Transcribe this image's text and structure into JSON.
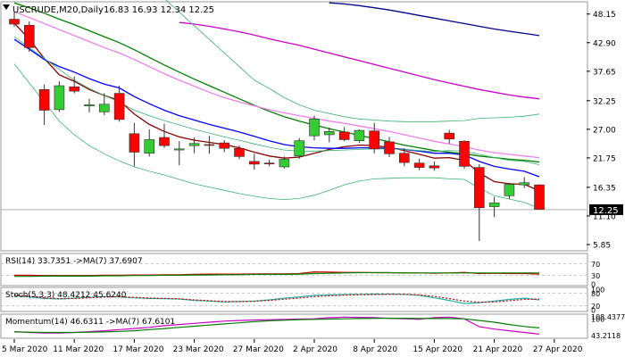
{
  "chart_data": {
    "type": "candlestick",
    "title": "USCRUDE,M20,Daily",
    "ohlc_label": "16.83 16.93 12.34 12.25",
    "last_price_label": "12.25",
    "last_price": 12.25,
    "y_ticks": [
      "48.15",
      "42.90",
      "37.65",
      "32.25",
      "27.00",
      "21.75",
      "16.35",
      "11.10",
      "5.85"
    ],
    "y_tick_values": [
      48.15,
      42.9,
      37.65,
      32.25,
      27.0,
      21.75,
      16.35,
      11.1,
      5.85
    ],
    "ylim": [
      4.7,
      50.4
    ],
    "x_labels": [
      "5 Mar 2020",
      "11 Mar 2020",
      "17 Mar 2020",
      "23 Mar 2020",
      "27 Mar 2020",
      "2 Apr 2020",
      "8 Apr 2020",
      "15 Apr 2020",
      "21 Apr 2020",
      "27 Apr 2020"
    ],
    "x_label_bar_index": [
      0,
      4,
      8,
      12,
      16,
      20,
      24,
      28,
      32,
      36
    ],
    "candles": [
      {
        "o": 47.2,
        "h": 48.5,
        "l": 45.8,
        "c": 46.3
      },
      {
        "o": 46.1,
        "h": 46.8,
        "l": 41.2,
        "c": 42.0
      },
      {
        "o": 34.3,
        "h": 35.2,
        "l": 27.8,
        "c": 30.5
      },
      {
        "o": 30.6,
        "h": 35.8,
        "l": 30.2,
        "c": 35.0
      },
      {
        "o": 34.8,
        "h": 36.7,
        "l": 33.6,
        "c": 34.0
      },
      {
        "o": 31.3,
        "h": 32.6,
        "l": 30.1,
        "c": 31.5
      },
      {
        "o": 30.2,
        "h": 33.6,
        "l": 29.6,
        "c": 31.6
      },
      {
        "o": 33.6,
        "h": 35.0,
        "l": 28.4,
        "c": 28.8
      },
      {
        "o": 26.2,
        "h": 28.2,
        "l": 20.2,
        "c": 22.8
      },
      {
        "o": 22.6,
        "h": 27.0,
        "l": 22.0,
        "c": 25.1
      },
      {
        "o": 25.5,
        "h": 28.0,
        "l": 23.6,
        "c": 24.0
      },
      {
        "o": 23.2,
        "h": 24.8,
        "l": 20.4,
        "c": 23.4
      },
      {
        "o": 24.0,
        "h": 25.5,
        "l": 22.6,
        "c": 24.4
      },
      {
        "o": 24.2,
        "h": 25.8,
        "l": 22.5,
        "c": 24.1
      },
      {
        "o": 24.5,
        "h": 25.0,
        "l": 22.8,
        "c": 23.5
      },
      {
        "o": 23.5,
        "h": 24.0,
        "l": 21.5,
        "c": 22.0
      },
      {
        "o": 21.1,
        "h": 22.5,
        "l": 19.6,
        "c": 20.6
      },
      {
        "o": 20.8,
        "h": 21.4,
        "l": 20.2,
        "c": 20.7
      },
      {
        "o": 20.1,
        "h": 22.0,
        "l": 19.8,
        "c": 21.5
      },
      {
        "o": 22.1,
        "h": 25.4,
        "l": 21.6,
        "c": 24.9
      },
      {
        "o": 25.8,
        "h": 29.5,
        "l": 25.0,
        "c": 28.9
      },
      {
        "o": 26.0,
        "h": 27.3,
        "l": 24.6,
        "c": 26.6
      },
      {
        "o": 26.5,
        "h": 27.4,
        "l": 24.8,
        "c": 25.1
      },
      {
        "o": 24.9,
        "h": 27.0,
        "l": 24.5,
        "c": 26.8
      },
      {
        "o": 26.7,
        "h": 28.2,
        "l": 22.6,
        "c": 23.4
      },
      {
        "o": 24.7,
        "h": 25.6,
        "l": 21.9,
        "c": 22.5
      },
      {
        "o": 22.6,
        "h": 23.5,
        "l": 20.2,
        "c": 20.9
      },
      {
        "o": 20.8,
        "h": 21.6,
        "l": 19.5,
        "c": 20.0
      },
      {
        "o": 20.3,
        "h": 21.1,
        "l": 19.4,
        "c": 19.9
      },
      {
        "o": 26.3,
        "h": 26.9,
        "l": 24.4,
        "c": 25.2
      },
      {
        "o": 24.8,
        "h": 25.0,
        "l": 19.8,
        "c": 20.2
      },
      {
        "o": 20.0,
        "h": 20.6,
        "l": 6.5,
        "c": 12.6
      },
      {
        "o": 12.8,
        "h": 14.6,
        "l": 10.9,
        "c": 13.5
      },
      {
        "o": 14.8,
        "h": 17.2,
        "l": 14.2,
        "c": 16.9
      },
      {
        "o": 16.8,
        "h": 18.2,
        "l": 16.2,
        "c": 17.2
      },
      {
        "o": 16.8,
        "h": 16.9,
        "l": 12.3,
        "c": 12.3
      }
    ],
    "overlay_lines": [
      {
        "role": "ma-darkred",
        "color": "#8b0000",
        "values": [
          46.5,
          43.5,
          40.0,
          37.0,
          35.8,
          34.3,
          33.2,
          32.3,
          29.8,
          27.9,
          26.6,
          25.6,
          25.0,
          24.6,
          24.2,
          23.6,
          22.8,
          22.1,
          21.7,
          21.9,
          22.6,
          23.3,
          23.8,
          24.1,
          24.0,
          23.7,
          23.1,
          22.4,
          21.7,
          21.8,
          21.3,
          19.0,
          17.4,
          17.0,
          16.9,
          15.7
        ]
      },
      {
        "role": "ma-blue",
        "color": "#0000ff",
        "values": [
          43.5,
          41.7,
          39.8,
          38.5,
          37.5,
          36.3,
          35.3,
          34.6,
          33.0,
          31.7,
          30.5,
          29.5,
          28.7,
          27.9,
          27.2,
          26.5,
          25.7,
          24.9,
          24.2,
          23.8,
          23.6,
          23.5,
          23.5,
          23.6,
          23.6,
          23.5,
          23.3,
          23.0,
          22.6,
          22.6,
          22.3,
          21.1,
          20.2,
          19.7,
          19.3,
          18.3
        ]
      },
      {
        "role": "ma-green",
        "color": "#008000",
        "values": [
          50.2,
          49.3,
          48.3,
          47.2,
          46.2,
          45.1,
          44.0,
          42.9,
          41.6,
          40.2,
          38.8,
          37.5,
          36.2,
          35.0,
          33.8,
          32.6,
          31.4,
          30.3,
          29.3,
          28.5,
          27.8,
          27.1,
          26.5,
          25.9,
          25.3,
          24.7,
          24.1,
          23.6,
          23.1,
          22.8,
          22.5,
          22.1,
          21.8,
          21.5,
          21.3,
          21.0
        ]
      },
      {
        "role": "ma-darkblue",
        "color": "#00008b",
        "values": [
          null,
          null,
          null,
          null,
          null,
          null,
          null,
          null,
          null,
          null,
          null,
          null,
          null,
          null,
          null,
          null,
          null,
          null,
          null,
          null,
          null,
          50.2,
          50.0,
          49.7,
          49.3,
          48.9,
          48.4,
          47.9,
          47.4,
          46.9,
          46.4,
          45.9,
          45.4,
          45.0,
          44.6,
          44.2
        ]
      },
      {
        "role": "ma-magenta",
        "color": "#cc00cc",
        "values": [
          null,
          null,
          null,
          null,
          null,
          null,
          null,
          null,
          null,
          null,
          null,
          46.6,
          46.3,
          45.9,
          45.4,
          44.9,
          44.3,
          43.6,
          43.0,
          42.4,
          41.7,
          41.0,
          40.3,
          39.6,
          38.9,
          38.2,
          37.5,
          36.8,
          36.1,
          35.5,
          34.9,
          34.3,
          33.8,
          33.3,
          32.9,
          32.6
        ]
      },
      {
        "role": "ma-violet",
        "color": "#ee82ee",
        "values": [
          48.6,
          47.5,
          46.4,
          45.3,
          44.2,
          43.1,
          42.0,
          41.0,
          39.8,
          38.5,
          37.2,
          36.0,
          34.9,
          33.8,
          32.8,
          32.0,
          31.3,
          30.6,
          30.0,
          29.5,
          29.0,
          28.5,
          28.1,
          27.6,
          27.1,
          26.6,
          26.0,
          25.4,
          24.8,
          24.3,
          23.8,
          23.2,
          22.7,
          22.4,
          22.1,
          21.8
        ]
      },
      {
        "role": "bollinger-upper",
        "color": "#3cb371",
        "values": [
          null,
          null,
          null,
          null,
          null,
          null,
          null,
          null,
          null,
          null,
          51.0,
          48.5,
          46.0,
          43.5,
          41.0,
          38.5,
          36.0,
          34.5,
          32.8,
          31.5,
          30.5,
          29.9,
          29.3,
          28.9,
          28.7,
          28.5,
          28.4,
          28.4,
          28.4,
          28.5,
          28.6,
          29.0,
          29.1,
          29.2,
          29.4,
          29.8
        ]
      },
      {
        "role": "bollinger-middle",
        "color": "#3cb371",
        "values": [
          44.0,
          42.0,
          40.0,
          38.0,
          36.0,
          34.5,
          33.2,
          32.0,
          30.5,
          29.5,
          28.6,
          27.8,
          27.0,
          26.3,
          25.6,
          25.0,
          24.3,
          23.7,
          23.2,
          23.0,
          23.0,
          23.1,
          23.2,
          23.3,
          23.4,
          23.4,
          23.3,
          23.1,
          22.9,
          23.1,
          23.0,
          22.4,
          21.8,
          21.3,
          21.1,
          20.5
        ]
      },
      {
        "role": "bollinger-lower",
        "color": "#3cb371",
        "values": [
          39.0,
          35.5,
          32.0,
          28.5,
          26.0,
          24.0,
          22.5,
          21.2,
          20.1,
          19.3,
          18.6,
          17.8,
          17.0,
          16.4,
          15.8,
          15.2,
          14.7,
          14.3,
          14.1,
          14.3,
          14.9,
          15.8,
          16.8,
          17.5,
          17.9,
          18.0,
          18.1,
          18.1,
          18.1,
          17.9,
          17.8,
          16.2,
          14.8,
          14.2,
          13.6,
          12.5
        ]
      }
    ],
    "panels": [
      {
        "label": "RSI(14) 33.7351 ->MA(7) 37.6907",
        "ticks": [
          "70",
          "30",
          "0"
        ],
        "tick_values": [
          70,
          30,
          0
        ],
        "ylim": [
          0,
          100
        ],
        "levels": [
          70,
          30
        ],
        "lines": [
          {
            "color": "#cc0000",
            "values": [
              30,
              30,
              29,
              29,
              29,
              29,
              30,
              30,
              31,
              31,
              32,
              32,
              33,
              34,
              34,
              34,
              35,
              35,
              35,
              36,
              42,
              41,
              40,
              40,
              39,
              39,
              38,
              38,
              37,
              38,
              40,
              36,
              37,
              36,
              36,
              34
            ]
          },
          {
            "color": "#008000",
            "values": [
              26,
              26,
              27,
              27,
              27,
              27,
              28,
              28,
              29,
              29,
              30,
              30,
              31,
              31,
              32,
              32,
              33,
              33,
              33,
              34,
              36,
              37,
              38,
              39,
              39,
              39,
              38,
              38,
              38,
              38,
              38,
              38,
              38,
              38,
              38,
              38
            ]
          }
        ]
      },
      {
        "label": "Stoch(5,3,3) 48.4212 45.6240",
        "ticks": [
          "100",
          "80",
          "20",
          "0"
        ],
        "tick_values": [
          100,
          80,
          20,
          0
        ],
        "ylim": [
          0,
          100
        ],
        "levels": [
          80,
          20
        ],
        "lines": [
          {
            "color": "#20b2aa",
            "values": [
              70,
              62,
              55,
              52,
              56,
              60,
              64,
              62,
              58,
              55,
              54,
              52,
              45,
              42,
              38,
              40,
              42,
              48,
              56,
              62,
              70,
              72,
              74,
              75,
              76,
              76,
              75,
              70,
              58,
              45,
              30,
              34,
              42,
              50,
              56,
              48
            ]
          },
          {
            "color": "#cc0000",
            "values": [
              72,
              66,
              58,
              54,
              55,
              58,
              62,
              63,
              60,
              57,
              55,
              53,
              48,
              44,
              40,
              39,
              41,
              45,
              51,
              57,
              64,
              68,
              71,
              73,
              74,
              75,
              75,
              72,
              65,
              54,
              42,
              36,
              38,
              44,
              50,
              52
            ]
          }
        ]
      },
      {
        "label": "Momentum(14) 46.6311 ->MA(7) 67.6101",
        "ticks": [
          "108.4377",
          "100",
          "43.2118"
        ],
        "tick_values": [
          108.4377,
          100,
          43.2118
        ],
        "ylim": [
          38,
          110
        ],
        "levels": [],
        "lines": [
          {
            "color": "#cc00cc",
            "values": [
              55,
              52,
              50,
              50,
              52,
              55,
              58,
              62,
              66,
              70,
              76,
              80,
              84,
              88,
              92,
              94,
              96,
              97,
              98,
              99,
              100,
              104,
              106,
              105,
              104,
              102,
              100,
              98,
              104,
              106,
              100,
              72,
              64,
              58,
              52,
              46
            ]
          },
          {
            "color": "#008000",
            "values": [
              54,
              53,
              52,
              52,
              52,
              53,
              54,
              56,
              58,
              62,
              66,
              70,
              74,
              78,
              82,
              86,
              90,
              93,
              95,
              97,
              98,
              99,
              100,
              101,
              102,
              102,
              102,
              101,
              101,
              101,
              100,
              94,
              88,
              80,
              73,
              68
            ]
          }
        ]
      }
    ]
  }
}
